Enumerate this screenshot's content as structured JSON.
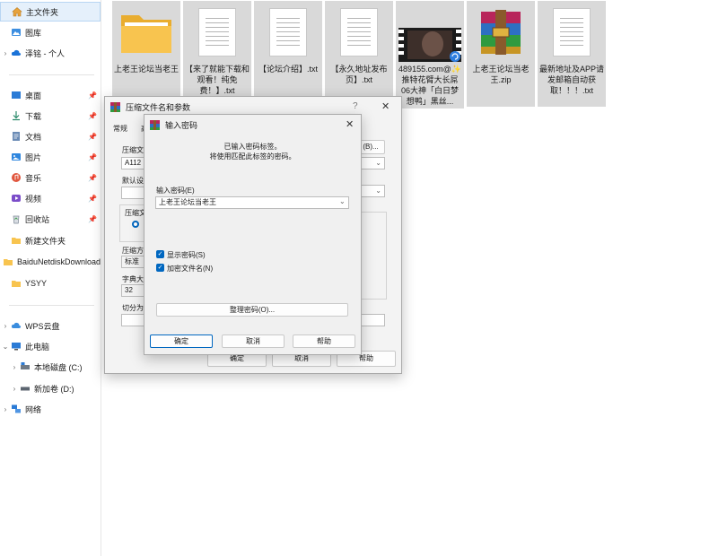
{
  "sidebar": {
    "items": [
      {
        "label": "主文件夹"
      },
      {
        "label": "图库"
      },
      {
        "label": "泽铭 - 个人"
      },
      {
        "label": "桌面"
      },
      {
        "label": "下载"
      },
      {
        "label": "文档"
      },
      {
        "label": "图片"
      },
      {
        "label": "音乐"
      },
      {
        "label": "视频"
      },
      {
        "label": "回收站"
      },
      {
        "label": "新建文件夹"
      },
      {
        "label": "BaiduNetdiskDownload"
      },
      {
        "label": "YSYY"
      },
      {
        "label": "WPS云盘"
      },
      {
        "label": "此电脑"
      },
      {
        "label": "本地磁盘 (C:)"
      },
      {
        "label": "新加卷 (D:)"
      },
      {
        "label": "网络"
      }
    ]
  },
  "files": [
    {
      "name": "上老王论坛当老王",
      "icon": "folder-icon"
    },
    {
      "name": "【来了就能下载和观看！纯免费！】.txt",
      "icon": "text-file-icon"
    },
    {
      "name": "【论坛介绍】.txt",
      "icon": "text-file-icon"
    },
    {
      "name": "【永久地址发布页】.txt",
      "icon": "text-file-icon"
    },
    {
      "name": "489155.com@✨推特花臂大长屌06大神「白日梦想鸭」黑丝...",
      "icon": "video-thumbnail"
    },
    {
      "name": "上老王论坛当老王.zip",
      "icon": "winrar-archive-icon"
    },
    {
      "name": "最新地址及APP请发邮箱自动获取！！！.txt",
      "icon": "text-file-icon"
    }
  ],
  "archive_dialog": {
    "title": "压缩文件名和参数",
    "help_glyph": "?",
    "close_glyph": "✕",
    "tabs": [
      "常规",
      "高"
    ],
    "archive_name_label": "压缩文件",
    "archive_name_value": "A112",
    "browse_label": "(B)...",
    "profile_label": "默认设",
    "format_label": "压缩文",
    "method_label": "压缩方",
    "method_value": "标准",
    "dict_label": "字典大小",
    "dict_value": "32",
    "split_label": "切分为分",
    "ok_label": "确定",
    "cancel_label": "取消",
    "help_label": "帮助"
  },
  "password_dialog": {
    "title": "输入密码",
    "close_glyph": "✕",
    "message_line1": "已输入密码标签。",
    "message_line2": "将使用匹配此标签的密码。",
    "password_label": "输入密码(E)",
    "password_value": "上老王论坛当老王",
    "show_password_label": "显示密码(S)",
    "encrypt_names_label": "加密文件名(N)",
    "organize_label": "整理密码(O)...",
    "ok_label": "确定",
    "cancel_label": "取消",
    "help_label": "帮助"
  },
  "colors": {
    "accent": "#0067c0",
    "folder": "#f8c44f",
    "selection": "#e5f0fb"
  }
}
